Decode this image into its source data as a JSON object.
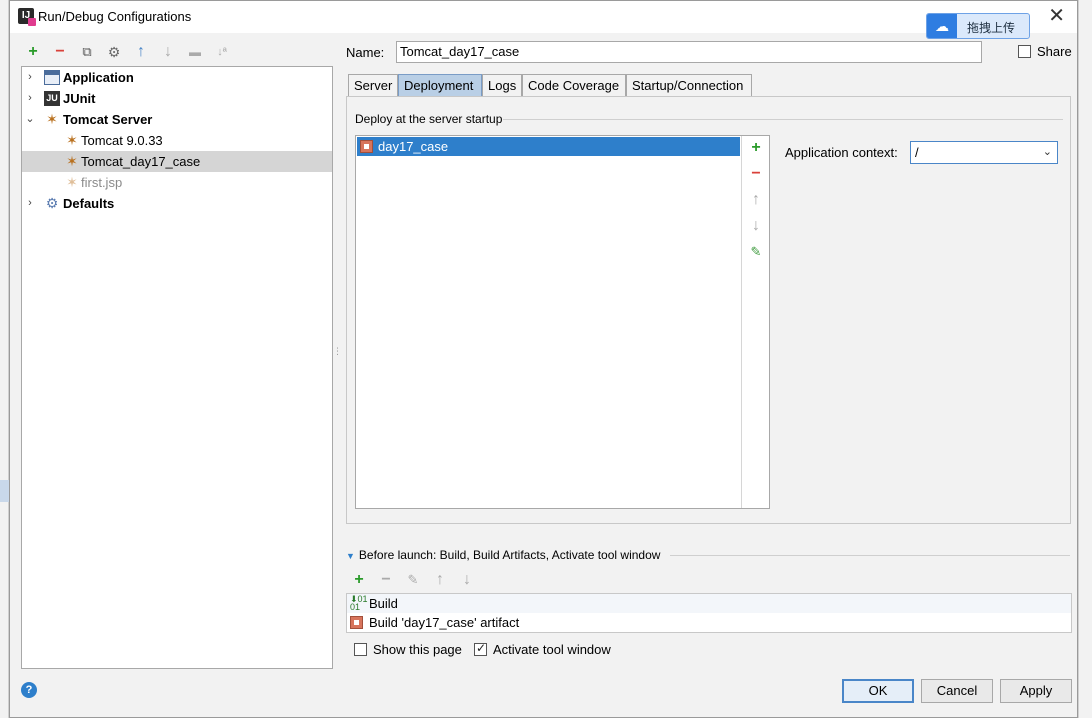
{
  "window": {
    "title": "Run/Debug Configurations",
    "close_glyph": "✕"
  },
  "overlay": {
    "cloud_upload_label": "拖拽上传"
  },
  "toolbar": {
    "add": "+",
    "remove": "−",
    "copy": "⧉",
    "edit_defaults": "⚙",
    "move_up": "↑",
    "move_down": "↓",
    "folder": "▬",
    "sort": "↓ª"
  },
  "tree": {
    "items": [
      {
        "label": "Application",
        "icon": "application-icon"
      },
      {
        "label": "JUnit",
        "icon": "junit-icon"
      },
      {
        "label": "Tomcat Server",
        "icon": "tomcat-icon"
      },
      {
        "label": "Tomcat 9.0.33",
        "icon": "tomcat-icon"
      },
      {
        "label": "Tomcat_day17_case",
        "icon": "tomcat-icon"
      },
      {
        "label": "first.jsp",
        "icon": "tomcat-icon"
      },
      {
        "label": "Defaults",
        "icon": "defaults-icon"
      }
    ]
  },
  "form": {
    "name_label": "Name:",
    "name_value": "Tomcat_day17_case",
    "share_label": "Share",
    "share_checked": false
  },
  "tabs": [
    {
      "label": "Server"
    },
    {
      "label": "Deployment"
    },
    {
      "label": "Logs"
    },
    {
      "label": "Code Coverage"
    },
    {
      "label": "Startup/Connection"
    }
  ],
  "deployment": {
    "section_title": "Deploy at the server startup",
    "items": [
      {
        "label": "day17_case"
      }
    ],
    "context_label": "Application context:",
    "context_value": "/"
  },
  "before_launch": {
    "title": "Before launch: Build, Build Artifacts, Activate tool window",
    "items": [
      {
        "label": "Build"
      },
      {
        "label": "Build 'day17_case' artifact"
      }
    ]
  },
  "options": {
    "show_page_label": "Show this page",
    "show_page_checked": false,
    "activate_label": "Activate tool window",
    "activate_checked": true
  },
  "buttons": {
    "help": "?",
    "ok": "OK",
    "cancel": "Cancel",
    "apply": "Apply"
  },
  "colors": {
    "selection": "#2e7fcb",
    "active_tab": "#b9cfe6",
    "add_green": "#2a9b2a",
    "remove_red": "#d9413a"
  }
}
